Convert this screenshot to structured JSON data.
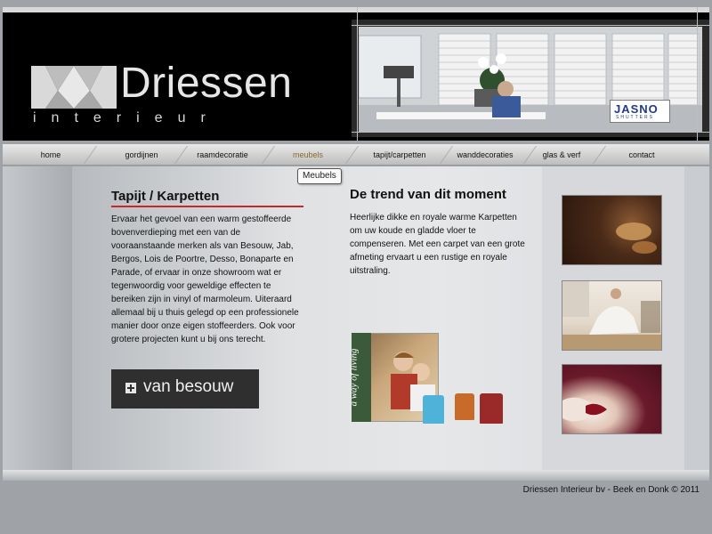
{
  "brand": {
    "name": "Driessen",
    "subtitle": "interieur"
  },
  "header": {
    "photo_badge": {
      "name": "JASNO",
      "sub": "SHUTTERS"
    }
  },
  "nav": {
    "items": [
      {
        "label": "home"
      },
      {
        "label": "gordijnen"
      },
      {
        "label": "raamdecoratie"
      },
      {
        "label": "meubels"
      },
      {
        "label": "tapijt/carpetten"
      },
      {
        "label": "wanddecoraties"
      },
      {
        "label": "glas & verf"
      },
      {
        "label": "contact"
      }
    ],
    "active": "meubels",
    "tooltip": "Meubels"
  },
  "left": {
    "heading": "Tapijt / Karpetten",
    "body": "Ervaar het gevoel van een warm gestoffeerde bovenverdieping met een van de vooraanstaande merken als van Besouw, Jab, Bergos, Lois de Poortre, Desso, Bonaparte en Parade, of ervaar in onze showroom wat er tegenwoordig voor geweldige effecten te bereiken zijn in vinyl of marmoleum. Uiteraard allemaal bij u thuis gelegd op een professionele manier door onze eigen stoffeerders. Ook voor grotere projecten kunt u bij ons terecht.",
    "brand_logo": "van besouw"
  },
  "middle": {
    "heading": "De trend van dit moment",
    "body": "Heerlijke dikke en royale warme Karpetten om uw koude en gladde vloer te compenseren. Met een carpet van een grote afmeting ervaart u een rustige en royale uitstraling.",
    "collage_text": "a way of living"
  },
  "footer": {
    "text": "Driessen Interieur bv - Beek en Donk © 2011"
  },
  "colors": {
    "accent_red": "#c62828",
    "nav_active": "#8a6a2a",
    "header_bg": "#000000"
  }
}
